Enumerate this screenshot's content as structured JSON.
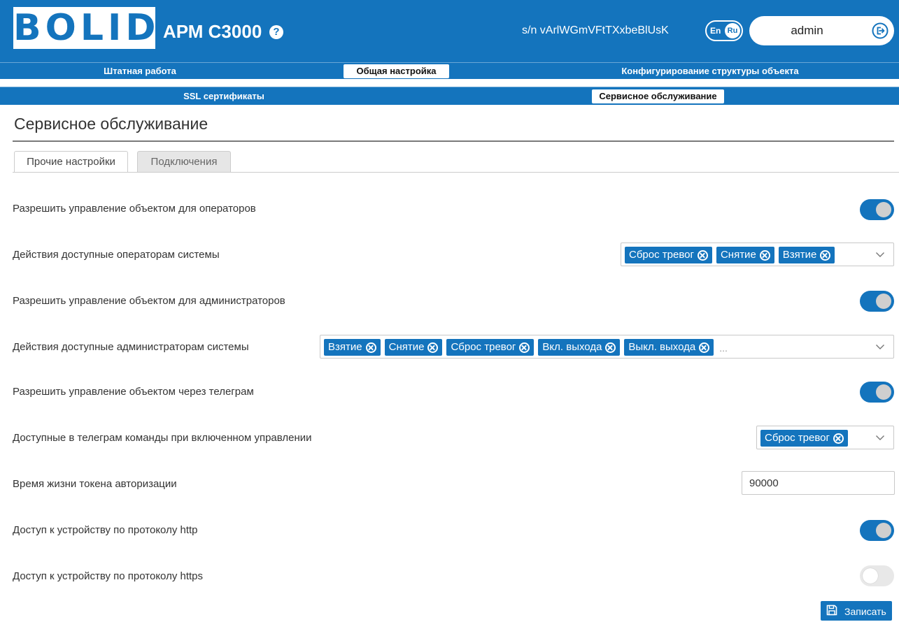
{
  "header": {
    "logo_text": "BOLID",
    "app_title": "АРМ С3000",
    "help_icon": "question-circle-icon",
    "serial": "s/n vArlWGmVFtTXxbeBlUsK",
    "lang": {
      "en": "En",
      "ru": "Ru"
    },
    "user": "admin",
    "logout_icon": "logout-icon",
    "color_primary": "#1474bd"
  },
  "nav": {
    "row1": [
      {
        "label": "Штатная работа",
        "active": false
      },
      {
        "label": "Общая настройка",
        "active": true
      },
      {
        "label": "Конфигурирование структуры объекта",
        "active": false
      }
    ],
    "row2": [
      {
        "label": "SSL сертификаты",
        "active": false
      },
      {
        "label": "Сервисное обслуживание",
        "active": true
      }
    ]
  },
  "page": {
    "title": "Сервисное обслуживание",
    "tabs": [
      {
        "label": "Прочие настройки",
        "active": true
      },
      {
        "label": "Подключения",
        "active": false
      }
    ]
  },
  "settings": {
    "operators_control": {
      "label": "Разрешить управление объектом для операторов",
      "enabled": true
    },
    "operators_actions": {
      "label": "Действия доступные операторам системы",
      "chips": [
        "Сброс тревог",
        "Снятие",
        "Взятие"
      ]
    },
    "admins_control": {
      "label": "Разрешить управление объектом для администраторов",
      "enabled": true
    },
    "admins_actions": {
      "label": "Действия доступные администраторам системы",
      "chips": [
        "Взятие",
        "Снятие",
        "Сброс тревог",
        "Вкл. выхода",
        "Выкл. выхода"
      ],
      "overflow": "..."
    },
    "telegram_control": {
      "label": "Разрешить управление объектом через телеграм",
      "enabled": true
    },
    "telegram_commands": {
      "label": "Доступные в телеграм команды при включенном управлении",
      "chips": [
        "Сброс тревог"
      ]
    },
    "token_lifetime": {
      "label": "Время жизни токена авторизации",
      "value": "90000"
    },
    "http_access": {
      "label": "Доступ к устройству по протоколу http",
      "enabled": true
    },
    "https_access": {
      "label": "Доступ к устройству по протоколу https",
      "enabled": false
    }
  },
  "actions": {
    "save_label": "Записать",
    "save_icon": "floppy-disk-icon"
  }
}
